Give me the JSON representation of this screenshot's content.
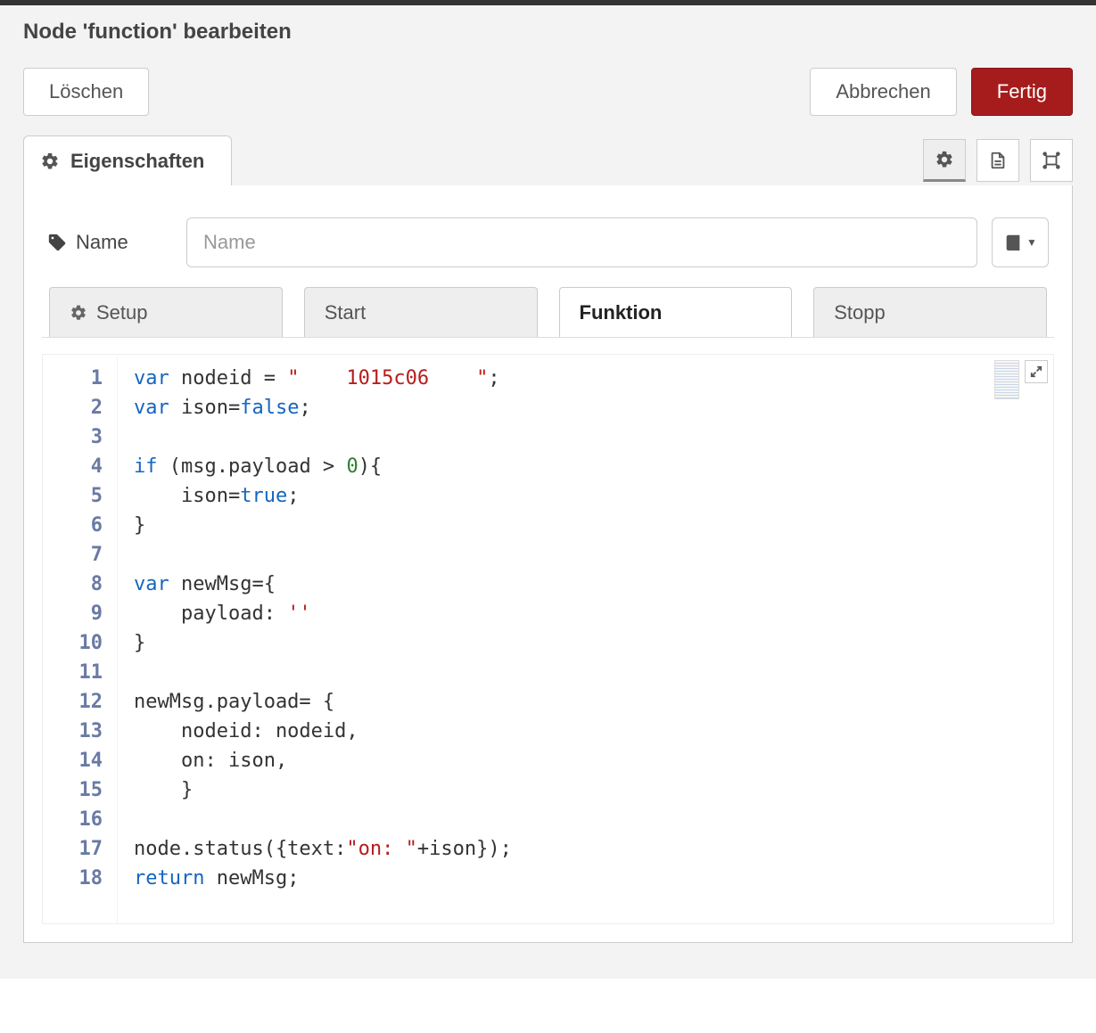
{
  "dialog": {
    "title": "Node 'function' bearbeiten",
    "buttons": {
      "delete": "Löschen",
      "cancel": "Abbrechen",
      "done": "Fertig"
    },
    "properties_tab": "Eigenschaften"
  },
  "form": {
    "name_label": "Name",
    "name_value": "",
    "name_placeholder": "Name"
  },
  "code_tabs": {
    "setup": "Setup",
    "start": "Start",
    "function": "Funktion",
    "stop": "Stopp",
    "active": "function"
  },
  "code": {
    "line_count": 18,
    "lines": [
      {
        "n": 1,
        "tokens": [
          {
            "t": "var ",
            "c": "kw"
          },
          {
            "t": "nodeid = "
          },
          {
            "t": "\"    1015c06    \"",
            "c": "str"
          },
          {
            "t": ";"
          }
        ]
      },
      {
        "n": 2,
        "tokens": [
          {
            "t": "var ",
            "c": "kw"
          },
          {
            "t": "ison="
          },
          {
            "t": "false",
            "c": "lit"
          },
          {
            "t": ";"
          }
        ]
      },
      {
        "n": 3,
        "tokens": [
          {
            "t": ""
          }
        ]
      },
      {
        "n": 4,
        "tokens": [
          {
            "t": "if ",
            "c": "kw"
          },
          {
            "t": "(msg.payload > "
          },
          {
            "t": "0",
            "c": "num"
          },
          {
            "t": "){"
          }
        ]
      },
      {
        "n": 5,
        "tokens": [
          {
            "t": "    ison="
          },
          {
            "t": "true",
            "c": "lit"
          },
          {
            "t": ";"
          }
        ]
      },
      {
        "n": 6,
        "tokens": [
          {
            "t": "}"
          }
        ]
      },
      {
        "n": 7,
        "tokens": [
          {
            "t": ""
          }
        ]
      },
      {
        "n": 8,
        "tokens": [
          {
            "t": "var ",
            "c": "kw"
          },
          {
            "t": "newMsg={"
          }
        ]
      },
      {
        "n": 9,
        "tokens": [
          {
            "t": "    payload: "
          },
          {
            "t": "''",
            "c": "str"
          }
        ]
      },
      {
        "n": 10,
        "tokens": [
          {
            "t": "}"
          }
        ]
      },
      {
        "n": 11,
        "tokens": [
          {
            "t": ""
          }
        ]
      },
      {
        "n": 12,
        "tokens": [
          {
            "t": "newMsg.payload= {"
          }
        ]
      },
      {
        "n": 13,
        "tokens": [
          {
            "t": "    nodeid: nodeid,"
          }
        ]
      },
      {
        "n": 14,
        "tokens": [
          {
            "t": "    on: ison,"
          }
        ]
      },
      {
        "n": 15,
        "tokens": [
          {
            "t": "    }"
          }
        ]
      },
      {
        "n": 16,
        "tokens": [
          {
            "t": ""
          }
        ]
      },
      {
        "n": 17,
        "tokens": [
          {
            "t": "node.status({text:"
          },
          {
            "t": "\"on: \"",
            "c": "str"
          },
          {
            "t": "+ison});"
          }
        ]
      },
      {
        "n": 18,
        "tokens": [
          {
            "t": "return ",
            "c": "kw"
          },
          {
            "t": "newMsg;"
          }
        ]
      }
    ]
  }
}
